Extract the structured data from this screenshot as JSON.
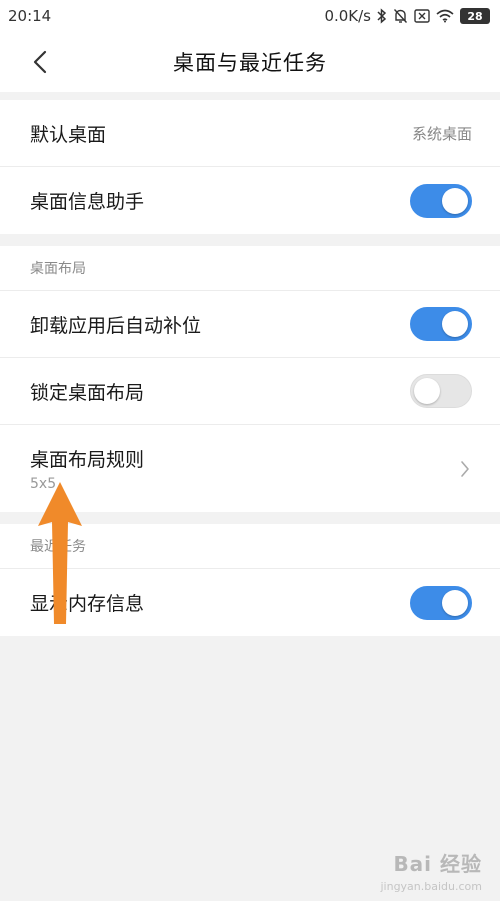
{
  "status_bar": {
    "time": "20:14",
    "network_speed": "0.0K/s",
    "battery": "28",
    "icons": [
      "bluetooth-icon",
      "mute-bell-icon",
      "sim-off-icon",
      "wifi-icon",
      "battery-icon"
    ]
  },
  "header": {
    "title": "桌面与最近任务",
    "back_icon": "chevron-left-icon"
  },
  "group_general": {
    "default_launcher": {
      "label": "默认桌面",
      "value": "系统桌面"
    },
    "desktop_assistant": {
      "label": "桌面信息助手",
      "enabled": true
    }
  },
  "group_layout": {
    "title": "桌面布局",
    "auto_fill": {
      "label": "卸载应用后自动补位",
      "enabled": true
    },
    "lock_layout": {
      "label": "锁定桌面布局",
      "enabled": false
    },
    "layout_rule": {
      "label": "桌面布局规则",
      "value": "5x5"
    }
  },
  "group_recent": {
    "title": "最近任务",
    "show_memory": {
      "label": "显示内存信息",
      "enabled": true
    }
  },
  "colors": {
    "toggle_on": "#3d8ce8",
    "toggle_off": "#e6e6e6",
    "annotation_arrow": "#f08a2a"
  },
  "watermark": {
    "text": "Bai 经验",
    "sub": "jingyan.baidu.com"
  }
}
